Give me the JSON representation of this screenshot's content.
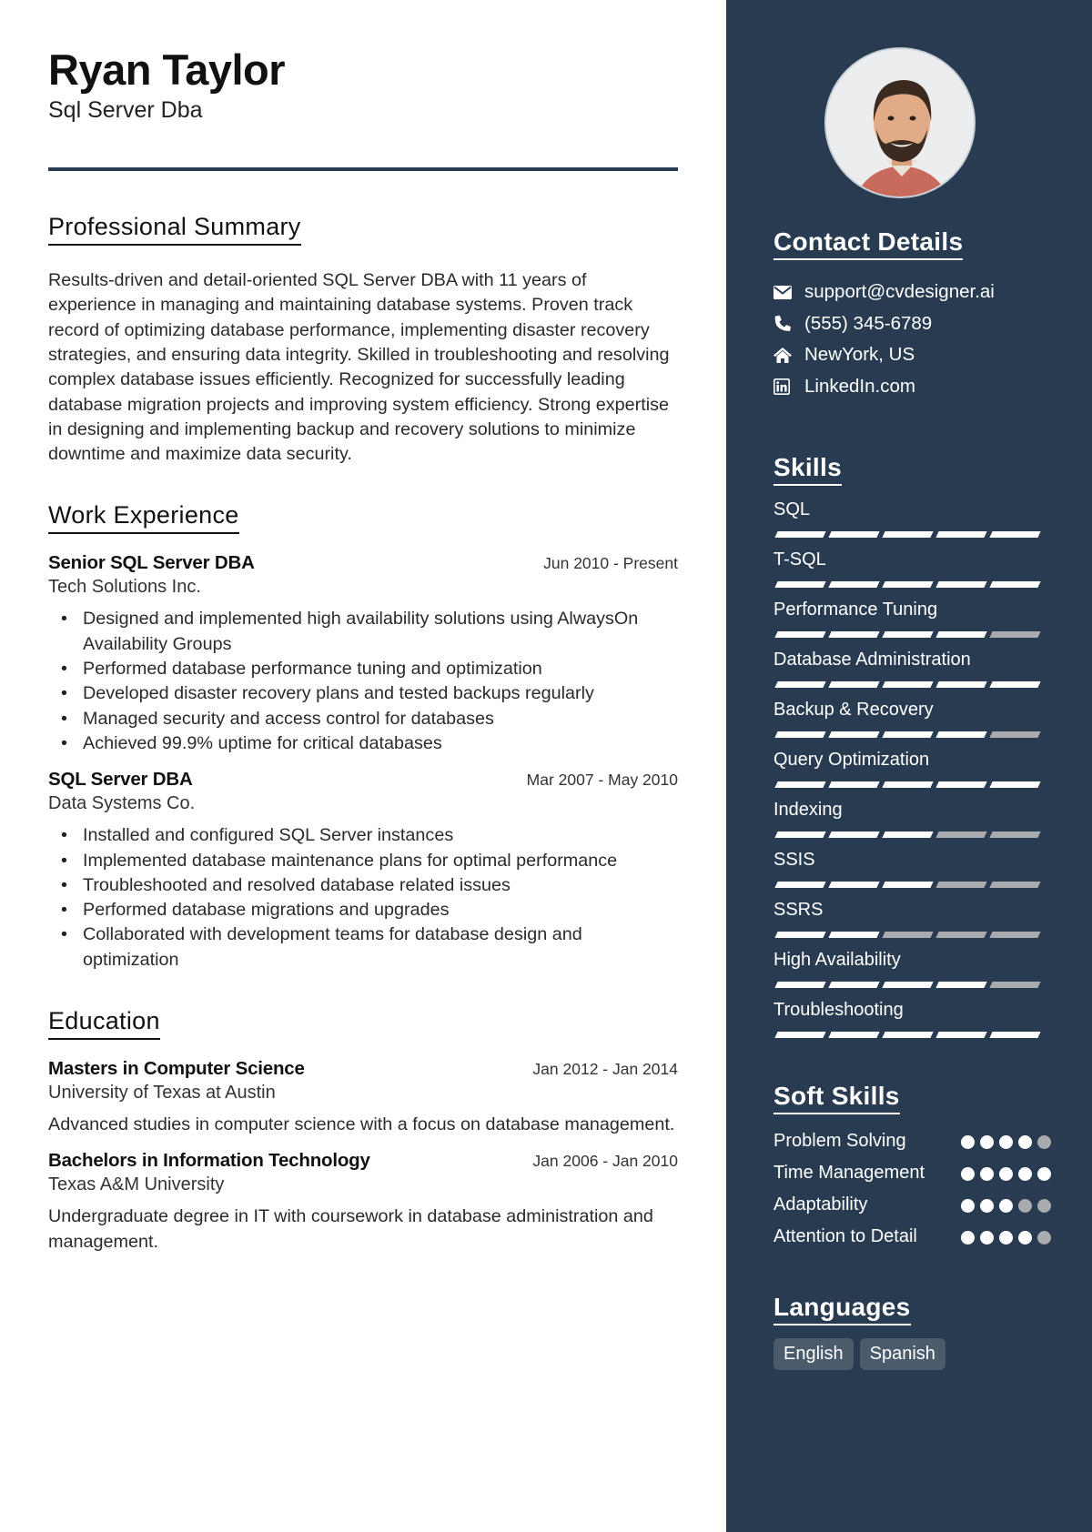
{
  "header": {
    "name": "Ryan Taylor",
    "title": "Sql Server Dba"
  },
  "summary": {
    "heading": "Professional Summary",
    "text": "Results-driven and detail-oriented SQL Server DBA with 11 years of experience in managing and maintaining database systems. Proven track record of optimizing database performance, implementing disaster recovery strategies, and ensuring data integrity. Skilled in troubleshooting and resolving complex database issues efficiently. Recognized for successfully leading database migration projects and improving system efficiency. Strong expertise in designing and implementing backup and recovery solutions to minimize downtime and maximize data security."
  },
  "experience": {
    "heading": "Work Experience",
    "jobs": [
      {
        "role": "Senior SQL Server DBA",
        "dates": "Jun 2010 - Present",
        "company": "Tech Solutions Inc.",
        "bullets": [
          "Designed and implemented high availability solutions using AlwaysOn Availability Groups",
          "Performed database performance tuning and optimization",
          "Developed disaster recovery plans and tested backups regularly",
          "Managed security and access control for databases",
          "Achieved 99.9% uptime for critical databases"
        ]
      },
      {
        "role": "SQL Server DBA",
        "dates": "Mar 2007 - May 2010",
        "company": "Data Systems Co.",
        "bullets": [
          "Installed and configured SQL Server instances",
          "Implemented database maintenance plans for optimal performance",
          "Troubleshooted and resolved database related issues",
          "Performed database migrations and upgrades",
          "Collaborated with development teams for database design and optimization"
        ]
      }
    ]
  },
  "education": {
    "heading": "Education",
    "items": [
      {
        "degree": "Masters in Computer Science",
        "dates": "Jan 2012 - Jan 2014",
        "school": "University of Texas at Austin",
        "description": "Advanced studies in computer science with a focus on database management."
      },
      {
        "degree": "Bachelors in Information Technology",
        "dates": "Jan 2006 - Jan 2010",
        "school": "Texas A&M University",
        "description": "Undergraduate degree in IT with coursework in database administration and management."
      }
    ]
  },
  "sidebar": {
    "photo_alt": "Profile photo",
    "contact": {
      "heading": "Contact Details",
      "items": [
        {
          "icon": "envelope-icon",
          "text": "support@cvdesigner.ai"
        },
        {
          "icon": "phone-icon",
          "text": "(555) 345-6789"
        },
        {
          "icon": "home-icon",
          "text": "NewYork, US"
        },
        {
          "icon": "linkedin-icon",
          "text": "LinkedIn.com"
        }
      ]
    },
    "skills": {
      "heading": "Skills",
      "max": 5,
      "items": [
        {
          "name": "SQL",
          "level": 5
        },
        {
          "name": "T-SQL",
          "level": 5
        },
        {
          "name": "Performance Tuning",
          "level": 4
        },
        {
          "name": "Database Administration",
          "level": 5
        },
        {
          "name": "Backup & Recovery",
          "level": 4
        },
        {
          "name": "Query Optimization",
          "level": 5
        },
        {
          "name": "Indexing",
          "level": 3
        },
        {
          "name": "SSIS",
          "level": 3
        },
        {
          "name": "SSRS",
          "level": 2
        },
        {
          "name": "High Availability",
          "level": 4
        },
        {
          "name": "Troubleshooting",
          "level": 5
        }
      ]
    },
    "soft_skills": {
      "heading": "Soft Skills",
      "max": 5,
      "items": [
        {
          "name": "Problem Solving",
          "level": 4
        },
        {
          "name": "Time Management",
          "level": 5
        },
        {
          "name": "Adaptability",
          "level": 3
        },
        {
          "name": "Attention to Detail",
          "level": 4
        }
      ]
    },
    "languages": {
      "heading": "Languages",
      "items": [
        "English",
        "Spanish"
      ]
    }
  },
  "colors": {
    "sidebar_bg": "#283b50",
    "accent_rule": "#2b3d51",
    "rating_on": "#ffffff",
    "rating_off": "#a9abae",
    "language_badge": "#4b5b6c"
  }
}
